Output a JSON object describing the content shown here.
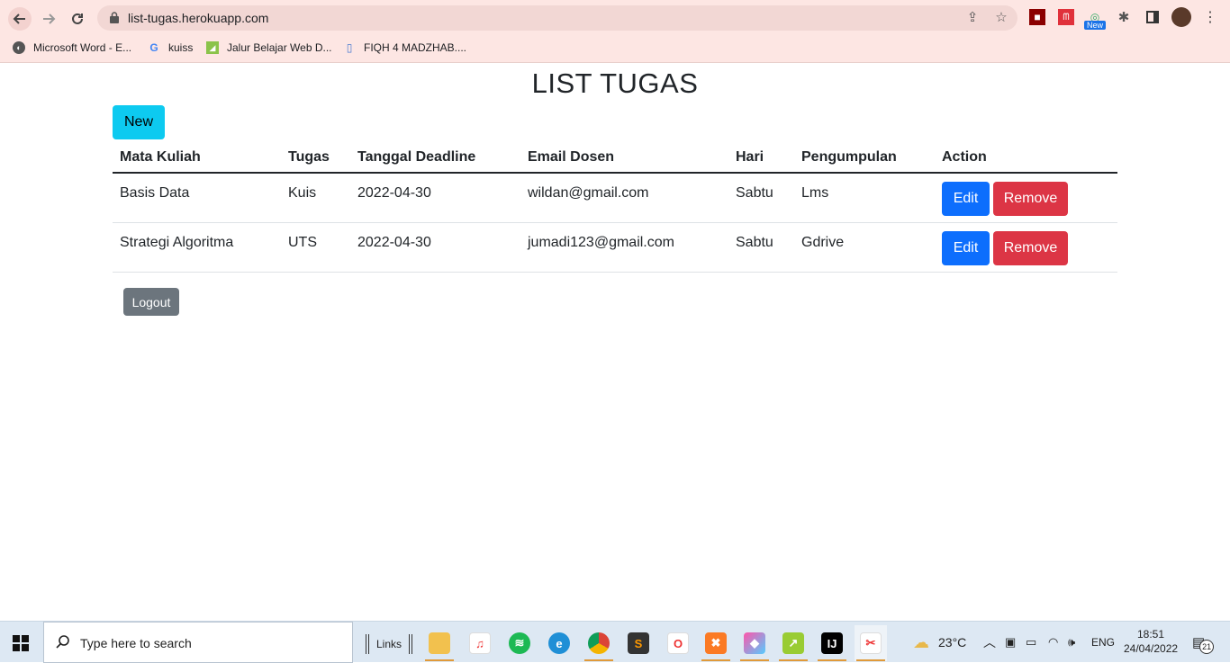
{
  "browser": {
    "url": "list-tugas.herokuapp.com",
    "new_badge": "New",
    "bookmarks": [
      {
        "label": "Microsoft Word - E...",
        "icon": "globe-icon"
      },
      {
        "label": "kuiss",
        "icon": "google-icon"
      },
      {
        "label": "Jalur Belajar Web D...",
        "icon": "dicoding-icon"
      },
      {
        "label": "FIQH 4 MADZHAB....",
        "icon": "document-icon"
      }
    ]
  },
  "page": {
    "title": "LIST TUGAS",
    "new_label": "New",
    "logout_label": "Logout",
    "table": {
      "headers": [
        "Mata Kuliah",
        "Tugas",
        "Tanggal Deadline",
        "Email Dosen",
        "Hari",
        "Pengumpulan",
        "Action"
      ],
      "rows": [
        {
          "mata_kuliah": "Basis Data",
          "tugas": "Kuis",
          "deadline": "2022-04-30",
          "email": "wildan@gmail.com",
          "hari": "Sabtu",
          "pengumpulan": "Lms",
          "edit": "Edit",
          "remove": "Remove"
        },
        {
          "mata_kuliah": "Strategi Algoritma",
          "tugas": "UTS",
          "deadline": "2022-04-30",
          "email": "jumadi123@gmail.com",
          "hari": "Sabtu",
          "pengumpulan": "Gdrive",
          "edit": "Edit",
          "remove": "Remove"
        }
      ]
    }
  },
  "taskbar": {
    "search_placeholder": "Type here to search",
    "links_label": "Links",
    "weather": "23°C",
    "lang": "ENG",
    "time": "18:51",
    "date": "24/04/2022",
    "notifications": "21"
  },
  "colors": {
    "info": "#0dcaf0",
    "primary": "#0d6efd",
    "danger": "#dc3545",
    "secondary": "#6c757d",
    "chrome_bg": "#fde6e3"
  }
}
